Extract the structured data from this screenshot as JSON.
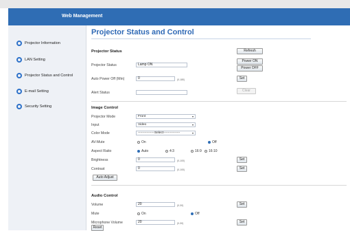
{
  "header": {
    "title": "Web Management"
  },
  "sidebar": {
    "items": [
      {
        "label": "Projector Information",
        "icon": "circle-icon"
      },
      {
        "label": "LAN Setting",
        "icon": "circle-icon"
      },
      {
        "label": "Projector Status and Control",
        "icon": "circle-icon"
      },
      {
        "label": "E-mail Setting",
        "icon": "circle-icon"
      },
      {
        "label": "Security Setting",
        "icon": "circle-icon"
      }
    ]
  },
  "main": {
    "title": "Projector Status and Control",
    "projector_status": {
      "section_title": "Projector Status",
      "status_label": "Projector Status",
      "status_value": "Lamp ON",
      "auto_power_off_label": "Auto Power Off (Min)",
      "auto_power_off_value": "0",
      "auto_power_off_range": "(0-180)",
      "alert_status_label": "Alert Status",
      "alert_status_value": "",
      "refresh_label": "Refresh",
      "power_on_label": "Power ON",
      "power_off_label": "Power OFF",
      "set_label": "Set",
      "clear_label": "Clear"
    },
    "image_control": {
      "section_title": "Image Control",
      "projector_mode_label": "Projector Mode",
      "projector_mode_value": "Front",
      "input_label": "Input",
      "input_value": "Video",
      "color_mode_label": "Color Mode",
      "color_mode_value": "---------------Select---------------",
      "av_mute_label": "AV-Mute",
      "av_mute_on": "On",
      "av_mute_off": "Off",
      "aspect_ratio_label": "Aspect Ratio",
      "aspect_auto": "Auto",
      "aspect_4_3": "4:3",
      "aspect_16_9": "16:9",
      "aspect_16_10": "16:10",
      "brightness_label": "Brightness",
      "brightness_value": "0",
      "brightness_range": "(0-100)",
      "contrast_label": "Contrast",
      "contrast_value": "0",
      "contrast_range": "(0-100)",
      "set_label": "Set",
      "auto_adjust_label": "Auto Adjust"
    },
    "audio_control": {
      "section_title": "Audio Control",
      "volume_label": "Volume",
      "volume_value": "20",
      "volume_range": "(0-30)",
      "mute_label": "Mute",
      "mute_on": "On",
      "mute_off": "Off",
      "mic_volume_label": "Microphone Volume",
      "mic_volume_value": "20",
      "mic_volume_range": "(0-30)",
      "set_label": "Set",
      "reset_label": "Reset"
    }
  }
}
